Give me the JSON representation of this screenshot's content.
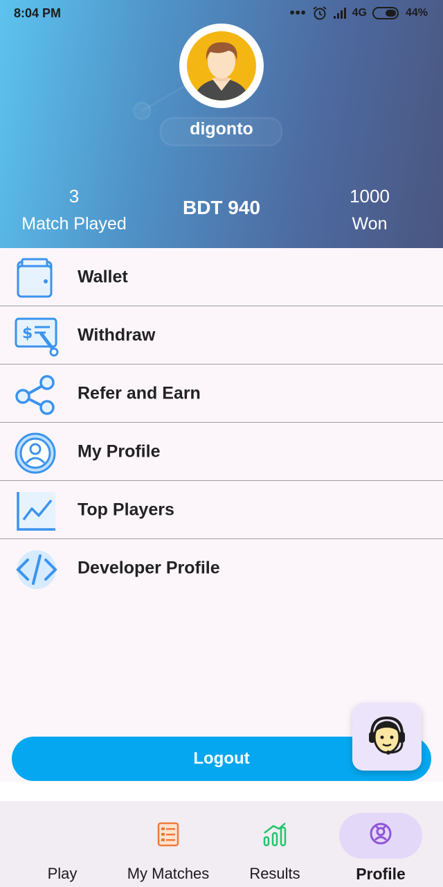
{
  "status_bar": {
    "time": "8:04 PM",
    "network": "4G",
    "battery": "44%"
  },
  "profile": {
    "username": "digonto",
    "matches_played": "3",
    "matches_played_label": "Match Played",
    "balance": "BDT 940",
    "won": "1000",
    "won_label": "Won"
  },
  "menu": {
    "items": [
      {
        "label": "Wallet",
        "icon": "wallet-icon"
      },
      {
        "label": "Withdraw",
        "icon": "withdraw-icon"
      },
      {
        "label": "Refer and Earn",
        "icon": "share-icon"
      },
      {
        "label": "My Profile",
        "icon": "user-icon"
      },
      {
        "label": "Top Players",
        "icon": "chart-icon"
      },
      {
        "label": "Developer Profile",
        "icon": "code-icon"
      }
    ]
  },
  "logout_label": "Logout",
  "bottom_nav": {
    "items": [
      {
        "label": "Play",
        "icon": "play-icon"
      },
      {
        "label": "My Matches",
        "icon": "list-icon"
      },
      {
        "label": "Results",
        "icon": "results-icon"
      },
      {
        "label": "Profile",
        "icon": "profile-icon",
        "active": true
      }
    ]
  },
  "colors": {
    "accent": "#05a8f0",
    "menu_icon": "#3b93ee",
    "nav_active_pill": "#e4d8f9"
  }
}
